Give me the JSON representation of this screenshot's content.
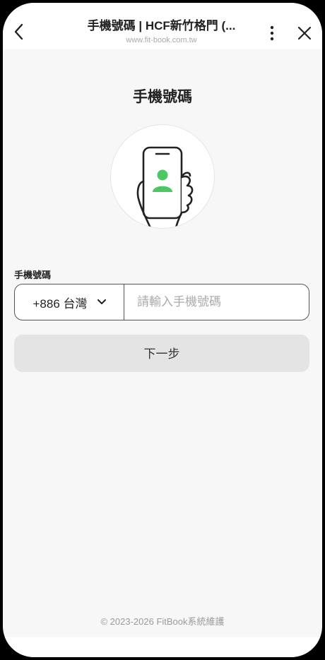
{
  "header": {
    "title": "手機號碼 | HCF新竹格門 (...",
    "url": "www.fit-book.com.tw",
    "icons": {
      "back": "chevron-left-icon",
      "more": "more-vertical-icon",
      "close": "close-icon"
    }
  },
  "main": {
    "title": "手機號碼",
    "illustration": "phone-user-icon",
    "field_label": "手機號碼",
    "country_code": "+886 台灣",
    "phone_placeholder": "請輸入手機號碼",
    "phone_value": "",
    "next_button": "下一步"
  },
  "footer": {
    "text": "© 2023-2026 FitBook系統維護"
  },
  "colors": {
    "accent_green": "#4cc764",
    "border": "#555555",
    "button_bg": "#e4e4e4"
  }
}
